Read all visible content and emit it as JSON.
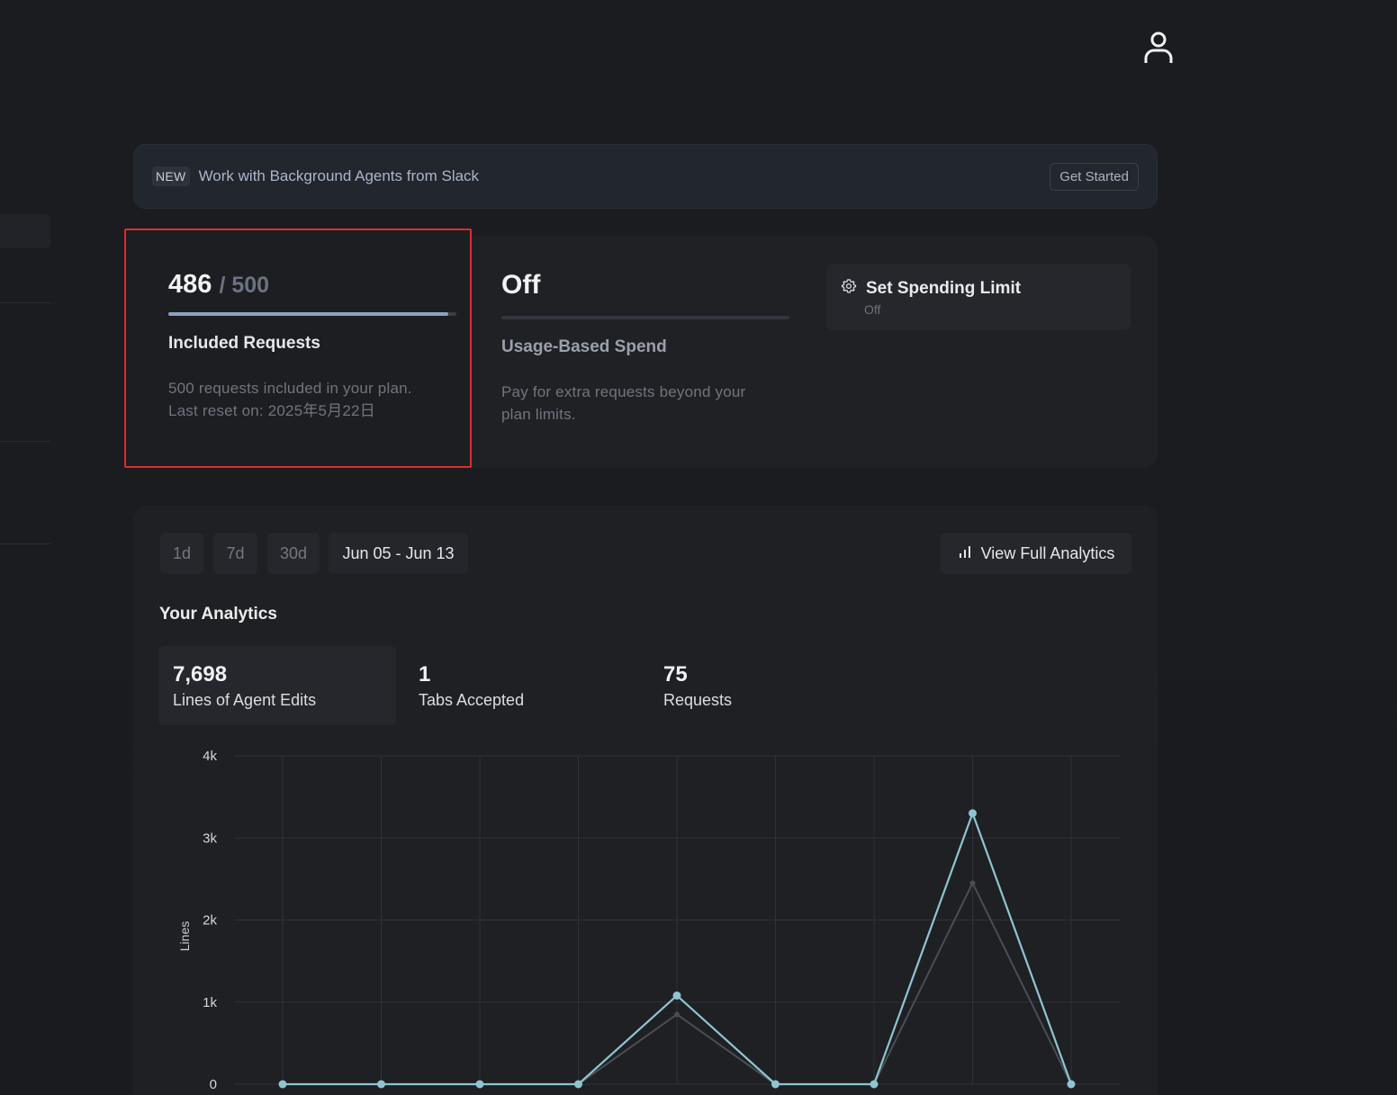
{
  "banner": {
    "badge": "NEW",
    "text": "Work with Background Agents from Slack",
    "cta": "Get Started"
  },
  "included": {
    "used": "486",
    "total": "/ 500",
    "progress": 0.972,
    "title": "Included Requests",
    "desc_line1": "500 requests included in your plan.",
    "desc_line2": "Last reset on: 2025年5月22日"
  },
  "usage_spend": {
    "status": "Off",
    "progress": 0,
    "title": "Usage-Based Spend",
    "desc_line1": "Pay for extra requests beyond your",
    "desc_line2": "plan limits."
  },
  "spending_limit": {
    "icon": "gear-icon",
    "title": "Set Spending Limit",
    "sub": "Off"
  },
  "range": {
    "options": [
      "1d",
      "7d",
      "30d"
    ],
    "selected": "Jun 05 - Jun 13"
  },
  "view_full": {
    "icon": "bar-chart-icon",
    "label": "View Full Analytics"
  },
  "analytics": {
    "title": "Your Analytics",
    "metrics": [
      {
        "value": "7,698",
        "label": "Lines of Agent Edits"
      },
      {
        "value": "1",
        "label": "Tabs Accepted"
      },
      {
        "value": "75",
        "label": "Requests"
      }
    ]
  },
  "colors": {
    "accent_line": "#8ec5d0",
    "secondary_line": "#4a4d53",
    "highlight_border": "#e02b2b"
  },
  "chart_data": {
    "type": "line",
    "ylabel": "Lines",
    "ylim": [
      0,
      4000
    ],
    "y_ticks": [
      "0",
      "1k",
      "2k",
      "3k",
      "4k"
    ],
    "x": [
      1,
      2,
      3,
      4,
      5,
      6,
      7,
      8,
      9
    ],
    "series": [
      {
        "values": [
          0,
          0,
          0,
          0,
          1080,
          0,
          0,
          3300,
          0
        ]
      },
      {
        "values": [
          0,
          0,
          0,
          0,
          850,
          0,
          0,
          2450,
          0
        ]
      }
    ],
    "grid": true
  }
}
